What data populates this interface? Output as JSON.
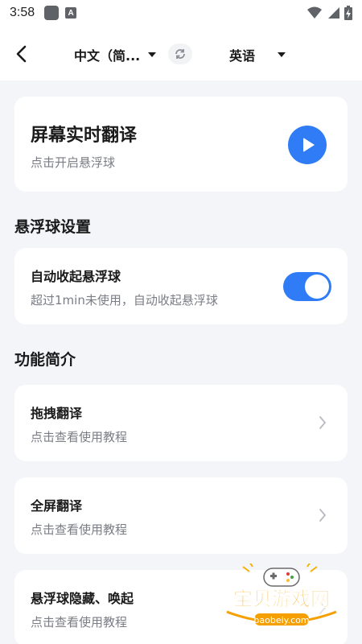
{
  "status_bar": {
    "time": "3:58",
    "icons": [
      "app-icon",
      "a-icon",
      "wifi-icon",
      "signal-icon",
      "battery-icon"
    ]
  },
  "top_bar": {
    "source_lang": "中文（简...",
    "target_lang": "英语",
    "icons": [
      "back-arrow-icon",
      "swap-icon",
      "caret-down-icon"
    ]
  },
  "hero": {
    "title": "屏幕实时翻译",
    "subtitle": "点击开启悬浮球",
    "icon": "play-icon"
  },
  "float_section": {
    "title": "悬浮球设置",
    "auto_collapse": {
      "title": "自动收起悬浮球",
      "subtitle": "超过1min未使用，自动收起悬浮球",
      "enabled": true
    }
  },
  "features_section": {
    "title": "功能简介",
    "items": [
      {
        "title": "拖拽翻译",
        "subtitle": "点击查看使用教程"
      },
      {
        "title": "全屏翻译",
        "subtitle": "点击查看使用教程"
      },
      {
        "title": "悬浮球隐藏、唤起",
        "subtitle": "点击查看使用教程"
      }
    ]
  },
  "watermark": {
    "text": "宝贝游戏网",
    "url": "baobeiy.com"
  },
  "colors": {
    "accent": "#2f7cf6",
    "background": "#f4f5f9",
    "card": "#ffffff",
    "secondary_text": "#7a7d85"
  }
}
